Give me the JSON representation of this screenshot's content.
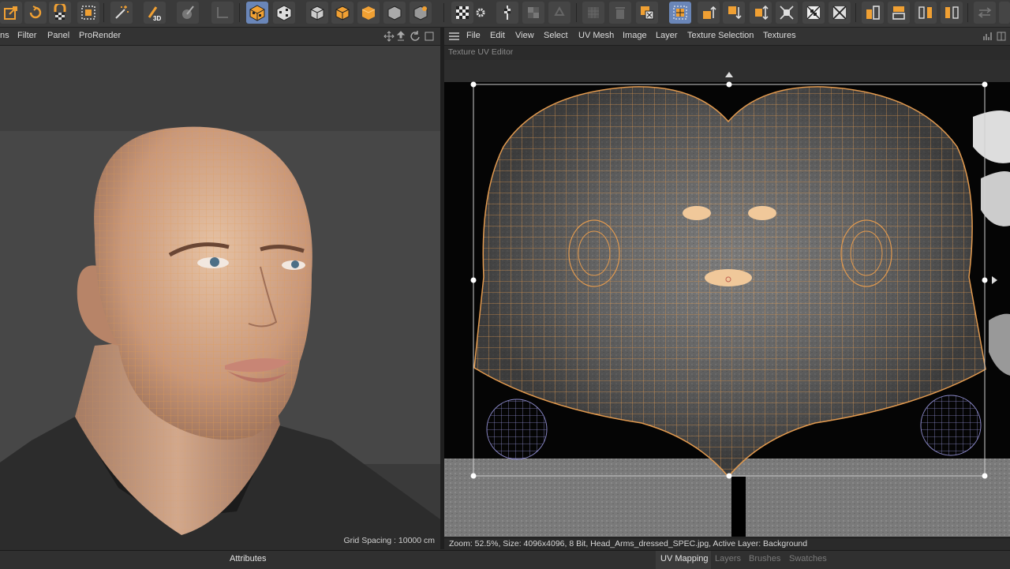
{
  "toolbar": {
    "badge_3d": "3D",
    "accent": "#f0a033"
  },
  "left_panel": {
    "menu": [
      {
        "label": "ns"
      },
      {
        "label": "Filter"
      },
      {
        "label": "Panel"
      },
      {
        "label": "ProRender"
      }
    ],
    "grid_spacing": "Grid Spacing : 10000 cm"
  },
  "right_panel": {
    "menu": [
      {
        "label": "File"
      },
      {
        "label": "Edit"
      },
      {
        "label": "View"
      },
      {
        "label": "Select"
      },
      {
        "label": "UV Mesh"
      },
      {
        "label": "Image"
      },
      {
        "label": "Layer"
      },
      {
        "label": "Texture Selection"
      },
      {
        "label": "Textures"
      }
    ],
    "editor_title": "Texture UV Editor",
    "status": "Zoom: 52.5%, Size: 4096x4096, 8 Bit, Head_Arms_dressed_SPEC.jpg, Active Layer: Background"
  },
  "bottom": {
    "attributes_tab": "Attributes",
    "tabs": [
      {
        "label": "UV Mapping"
      },
      {
        "label": "Layers"
      },
      {
        "label": "Brushes"
      },
      {
        "label": "Swatches"
      }
    ]
  },
  "colors": {
    "wire": "#e29a4f",
    "selection_blue": "#6a86b8"
  }
}
